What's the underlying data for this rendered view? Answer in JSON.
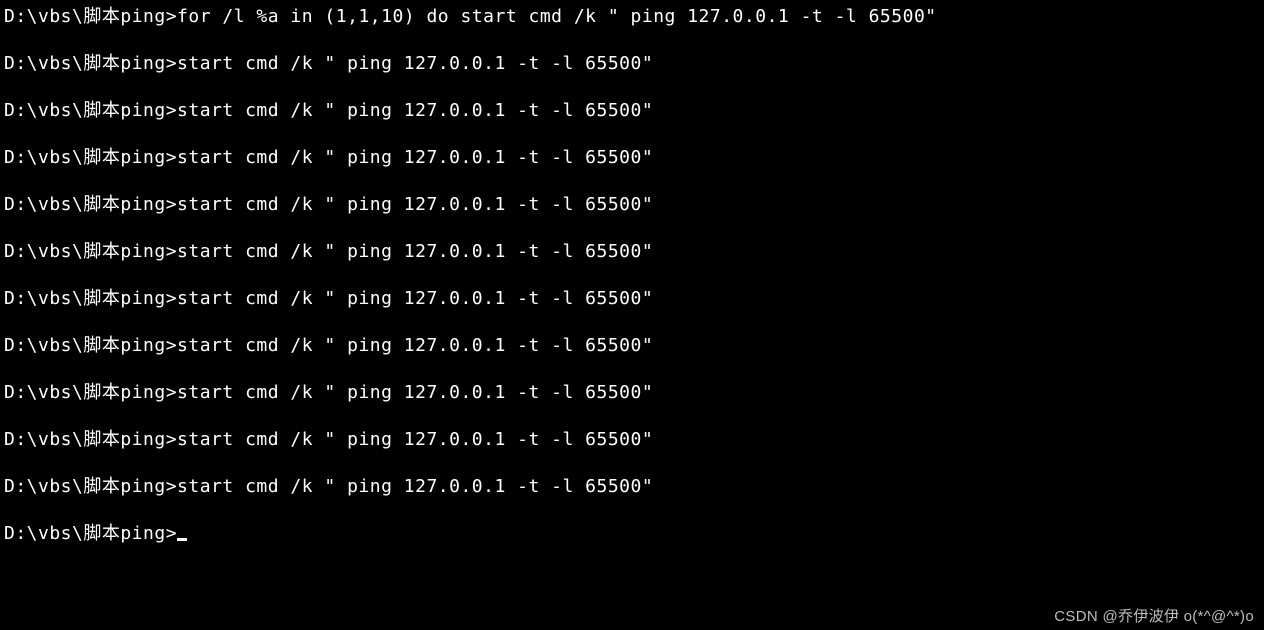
{
  "prompt_path": "D:\\vbs\\脚本ping>",
  "lines": [
    {
      "prompt": "D:\\vbs\\脚本ping>",
      "command": "for /l %a in (1,1,10) do start cmd /k \" ping 127.0.0.1 -t -l 65500\""
    },
    {
      "prompt": "D:\\vbs\\脚本ping>",
      "command": "start cmd /k \" ping 127.0.0.1 -t -l 65500\""
    },
    {
      "prompt": "D:\\vbs\\脚本ping>",
      "command": "start cmd /k \" ping 127.0.0.1 -t -l 65500\""
    },
    {
      "prompt": "D:\\vbs\\脚本ping>",
      "command": "start cmd /k \" ping 127.0.0.1 -t -l 65500\""
    },
    {
      "prompt": "D:\\vbs\\脚本ping>",
      "command": "start cmd /k \" ping 127.0.0.1 -t -l 65500\""
    },
    {
      "prompt": "D:\\vbs\\脚本ping>",
      "command": "start cmd /k \" ping 127.0.0.1 -t -l 65500\""
    },
    {
      "prompt": "D:\\vbs\\脚本ping>",
      "command": "start cmd /k \" ping 127.0.0.1 -t -l 65500\""
    },
    {
      "prompt": "D:\\vbs\\脚本ping>",
      "command": "start cmd /k \" ping 127.0.0.1 -t -l 65500\""
    },
    {
      "prompt": "D:\\vbs\\脚本ping>",
      "command": "start cmd /k \" ping 127.0.0.1 -t -l 65500\""
    },
    {
      "prompt": "D:\\vbs\\脚本ping>",
      "command": "start cmd /k \" ping 127.0.0.1 -t -l 65500\""
    },
    {
      "prompt": "D:\\vbs\\脚本ping>",
      "command": "start cmd /k \" ping 127.0.0.1 -t -l 65500\""
    },
    {
      "prompt": "D:\\vbs\\脚本ping>",
      "command": "",
      "cursor": true
    }
  ],
  "watermark": "CSDN @乔伊波伊 o(*^@^*)o"
}
